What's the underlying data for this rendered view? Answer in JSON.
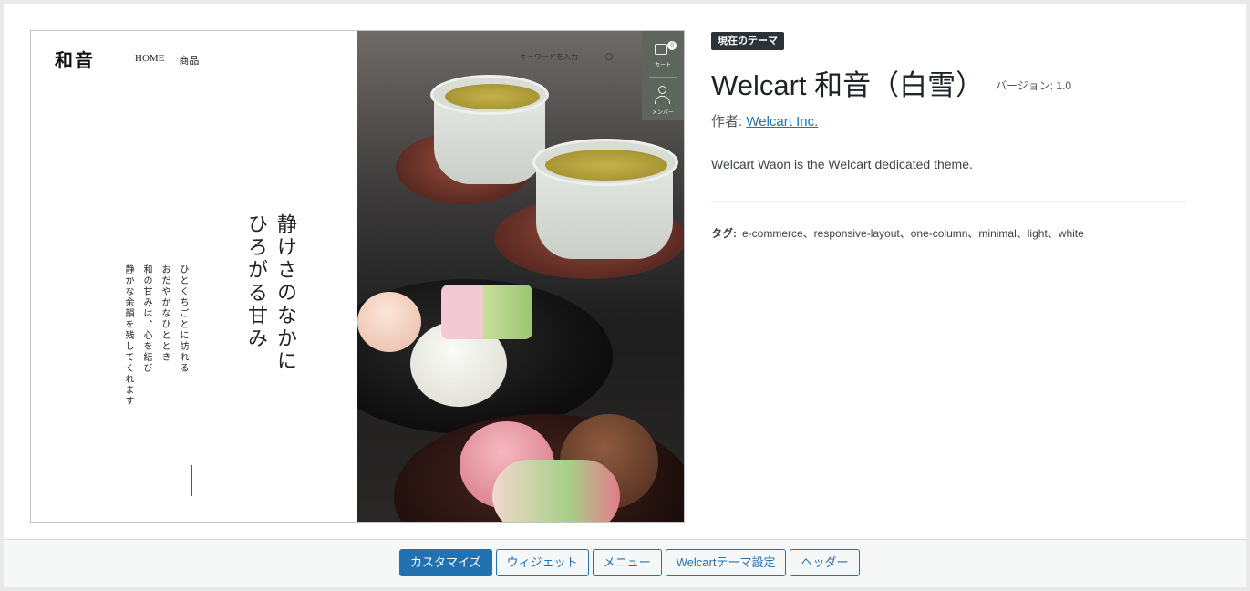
{
  "screenshot": {
    "logo": "和音",
    "nav": [
      "HOME",
      "商品"
    ],
    "search_placeholder": "キーワードを入力",
    "cart_label": "カート",
    "cart_count": "0",
    "member_label": "メンバー",
    "headline": "静けさのなかに\nひろがる甘み",
    "body_copy": "ひとくちごとに訪れる\nおだやかなひととき\n和の甘みは、心を結び\n静かな余韻を残してくれます"
  },
  "theme": {
    "badge": "現在のテーマ",
    "title": "Welcart 和音（白雪）",
    "version": "バージョン: 1.0",
    "author_label": "作者: ",
    "author_name": "Welcart Inc.",
    "description": "Welcart Waon is the Welcart dedicated theme.",
    "tags_label": "タグ:",
    "tags": "e-commerce、responsive-layout、one-column、minimal、light、white"
  },
  "actions": {
    "customize": "カスタマイズ",
    "widgets": "ウィジェット",
    "menus": "メニュー",
    "welcart_settings": "Welcartテーマ設定",
    "header": "ヘッダー"
  },
  "colors": {
    "primary": "#2271b1",
    "badge_bg": "#2c3338",
    "strip": "#5e655d"
  }
}
